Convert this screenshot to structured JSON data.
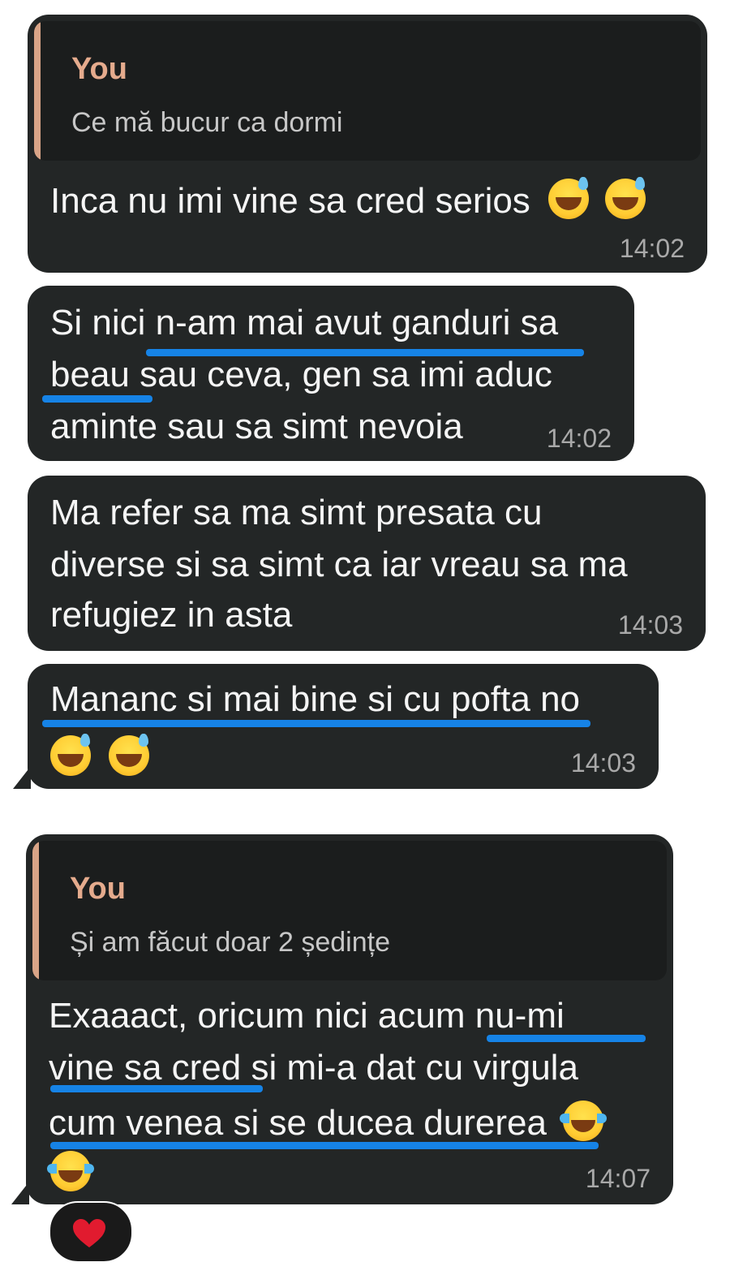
{
  "colors": {
    "bubble_bg": "#232626",
    "quote_bg": "#1b1d1d",
    "quote_bar": "#d9a487",
    "quote_author": "#e5ab8d",
    "underline": "#1683e6",
    "heart": "#e11b2f"
  },
  "messages": [
    {
      "quote_author": "You",
      "quote_text": "Ce mă bucur ca dormi",
      "lines": [
        "Inca nu imi vine sa cred serios"
      ],
      "emojis": [
        "grinning-sweat-emoji",
        "grinning-sweat-emoji"
      ],
      "time": "14:02"
    },
    {
      "lines": [
        "Si nici n-am mai avut ganduri sa",
        "beau sau ceva, gen sa imi aduc",
        "aminte sau sa simt nevoia"
      ],
      "time": "14:02"
    },
    {
      "lines": [
        "Ma refer sa ma simt presata cu",
        "diverse si sa simt ca iar vreau sa ma",
        "refugiez in asta"
      ],
      "time": "14:03"
    },
    {
      "lines": [
        "Mananc si mai bine si cu pofta no"
      ],
      "emojis": [
        "grinning-sweat-emoji",
        "grinning-sweat-emoji"
      ],
      "time": "14:03"
    },
    {
      "quote_author": "You",
      "quote_text": "Și am făcut doar 2 ședințe",
      "lines": [
        "Exaaact, oricum nici acum nu-mi",
        "vine sa cred si mi-a dat cu virgula",
        "cum venea si se ducea durerea"
      ],
      "emojis": [
        "tears-of-joy-emoji",
        "tears-of-joy-emoji"
      ],
      "time": "14:07"
    }
  ],
  "reaction": {
    "icon": "red-heart-icon"
  }
}
